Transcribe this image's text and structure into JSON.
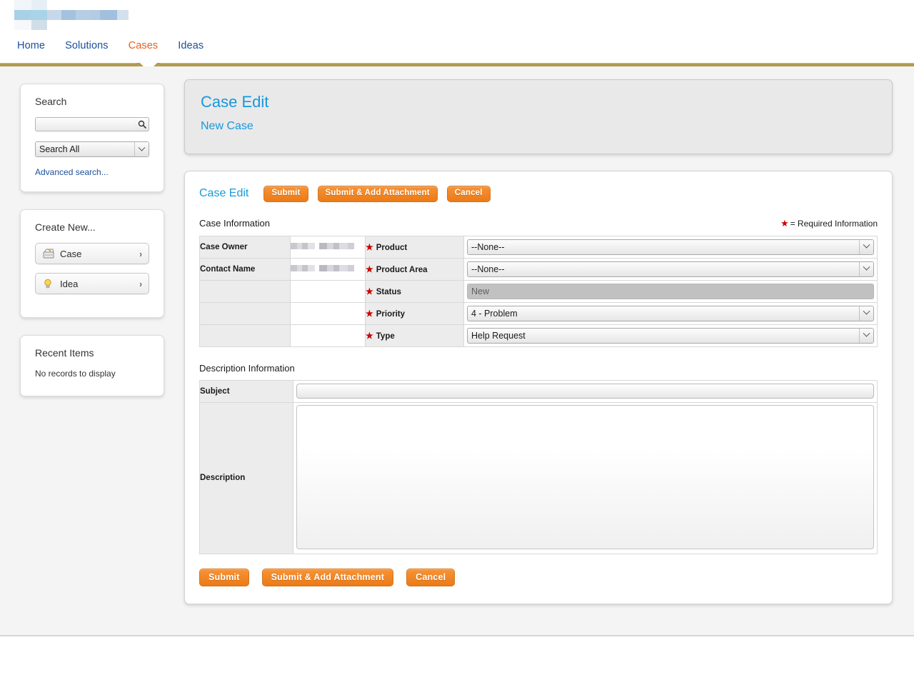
{
  "header": {
    "logo_alt": "company-logo-redacted",
    "nav": [
      {
        "label": "Home",
        "active": false
      },
      {
        "label": "Solutions",
        "active": false
      },
      {
        "label": "Cases",
        "active": true
      },
      {
        "label": "Ideas",
        "active": false
      }
    ]
  },
  "sidebar": {
    "search": {
      "title": "Search",
      "input_value": "",
      "input_placeholder": "",
      "scope_selected": "Search All",
      "scope_options": [
        "Search All"
      ],
      "advanced_link": "Advanced search..."
    },
    "create_new": {
      "title": "Create New...",
      "items": [
        {
          "label": "Case",
          "icon": "case-icon",
          "arrow": "›"
        },
        {
          "label": "Idea",
          "icon": "lightbulb-icon",
          "arrow": "›"
        }
      ]
    },
    "recent_items": {
      "title": "Recent Items",
      "empty_text": "No records to display"
    }
  },
  "main": {
    "page_title": "Case Edit",
    "page_subtitle": "New Case",
    "form_link": "Case Edit",
    "buttons": {
      "submit": "Submit",
      "submit_add_attachment": "Submit & Add Attachment",
      "cancel": "Cancel"
    },
    "case_information": {
      "section_title": "Case Information",
      "required_note": "= Required Information",
      "rows": [
        {
          "left_label": "Case Owner",
          "left_value_redacted": true,
          "right_label": "Product",
          "right_required": true,
          "right_type": "select",
          "right_value": "--None--",
          "right_options": [
            "--None--"
          ],
          "disabled": false
        },
        {
          "left_label": "Contact Name",
          "left_value_redacted": true,
          "right_label": "Product Area",
          "right_required": true,
          "right_type": "select",
          "right_value": "--None--",
          "right_options": [
            "--None--"
          ],
          "disabled": false
        },
        {
          "left_label": "",
          "left_value_redacted": false,
          "right_label": "Status",
          "right_required": true,
          "right_type": "select",
          "right_value": "New",
          "right_options": [
            "New"
          ],
          "disabled": true
        },
        {
          "left_label": "",
          "left_value_redacted": false,
          "right_label": "Priority",
          "right_required": true,
          "right_type": "select",
          "right_value": "4 - Problem",
          "right_options": [
            "4 - Problem"
          ],
          "disabled": false
        },
        {
          "left_label": "",
          "left_value_redacted": false,
          "right_label": "Type",
          "right_required": true,
          "right_type": "select",
          "right_value": "Help Request",
          "right_options": [
            "Help Request"
          ],
          "disabled": false
        }
      ]
    },
    "description_information": {
      "section_title": "Description Information",
      "subject_label": "Subject",
      "subject_value": "",
      "subject_placeholder": "",
      "description_label": "Description",
      "description_value": "",
      "description_placeholder": ""
    }
  },
  "colors": {
    "nav_link": "#1B4F9C",
    "nav_active": "#E8601C",
    "gold_bar": "#B09B4F",
    "title_blue": "#1798DB",
    "button_orange": "#EC7A16",
    "required_red": "#CC0000",
    "page_bg": "#F4F4F4"
  }
}
